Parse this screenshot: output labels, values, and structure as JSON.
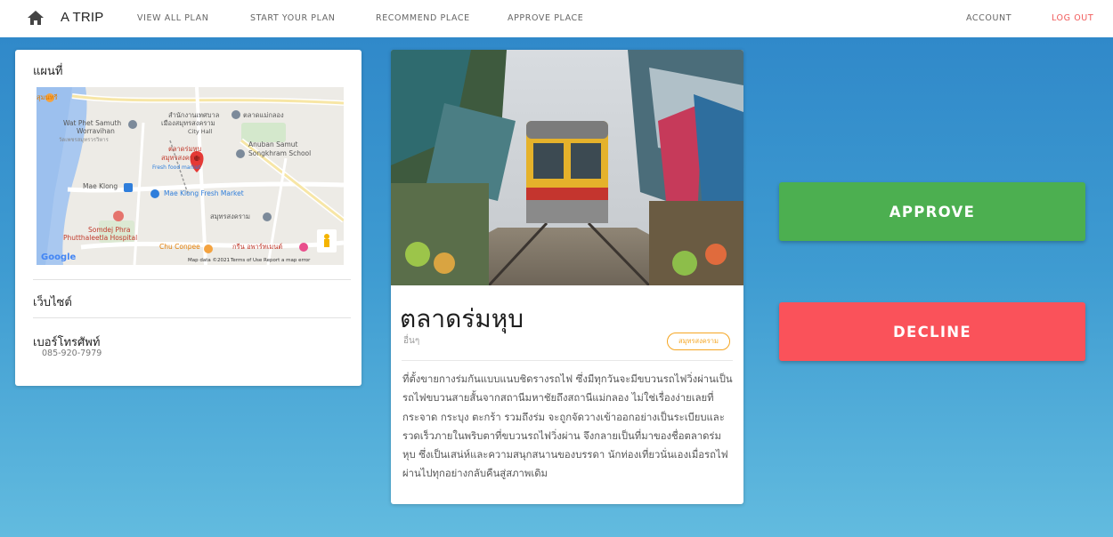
{
  "header": {
    "brand": "A TRIP",
    "nav": [
      {
        "label": "VIEW ALL PLAN"
      },
      {
        "label": "START YOUR PLAN"
      },
      {
        "label": "RECOMMEND PLACE"
      },
      {
        "label": "APPROVE PLACE"
      }
    ],
    "account_label": "ACCOUNT",
    "logout_label": "LOG OUT",
    "logout_color": "#F15A5A",
    "home_icon": "home-icon"
  },
  "info_card": {
    "title": "แผนที่",
    "map": {
      "labels": [
        "สุมนทรี",
        "Wat Phet Samuth",
        "Worravihan",
        "วัดเพชรสมุทรวรวิหาร",
        "สำนักงานเทศบาล",
        "เมืองสมุทรสงคราม",
        "City Hall",
        "ตลาดแม่กลอง",
        "Anuban Samut",
        "Songkhram School",
        "ตลาดร่มหุบ",
        "สมุทรสงคราม",
        "Fresh food market",
        "Mae Klong",
        "Mae Klong Fresh Market",
        "สมุทรสงคราม",
        "Somdej Phra",
        "Phutthaleetla Hospital",
        "Chu Conpee",
        "กรีน อพาร์ทเมนต์",
        "Google",
        "Map data ©2021",
        "Terms of Use",
        "Report a map error"
      ]
    },
    "website_label": "เว็บไซต์",
    "phone_label": "เบอร์โทรศัพท์",
    "phone_value": "085-920-7979"
  },
  "place": {
    "name": "ตลาดร่มหุบ",
    "category": "อื่นๆ",
    "province": "สมุทรสงคราม",
    "badge_color": "#F5A623",
    "description": "ที่ตั้งขายกางร่มกันแบบแนบชิดรางรถไฟ ซึ่งมีทุกวันจะมีขบวนรถไฟวิ่งผ่านเป็นรถไฟขบวนสายสั้นจากสถานีมหาชัยถึงสถานีแม่กลอง ไม่ใช่เรื่องง่ายเลยที่กระจาด กระบุง ตะกร้า รวมถึงร่ม จะถูกจัดวางเข้าออกอย่างเป็นระเบียบและรวดเร็วภายในพริบตาที่ขบวนรถไฟวิ่งผ่าน จึงกลายเป็นที่มาของชื่อตลาดร่มหุบ ซึ่งเป็นเสน่ห์และความสนุกสนานของบรรดา นักท่องเที่ยวนั่นเองเมื่อรถไฟผ่านไปทุกอย่างกลับคืนสู่สภาพเดิม"
  },
  "actions": {
    "approve_label": "APPROVE",
    "decline_label": "DECLINE",
    "approve_color": "#4CAF50",
    "decline_color": "#FA525A"
  }
}
